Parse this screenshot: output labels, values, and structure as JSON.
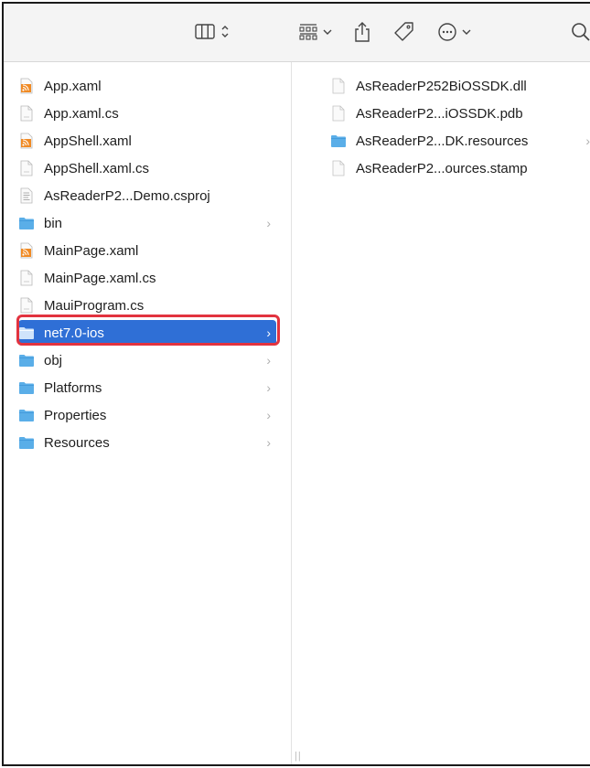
{
  "toolbar": {
    "icons": [
      "column-view-icon",
      "group-by-icon",
      "share-icon",
      "tag-icon",
      "more-actions-icon",
      "search-icon"
    ]
  },
  "colors": {
    "selection": "#2f6fd6",
    "highlight_border": "#e2333f",
    "folder": "#5aaee8"
  },
  "column1": {
    "items": [
      {
        "label": "App.xaml",
        "kind": "xaml"
      },
      {
        "label": "App.xaml.cs",
        "kind": "doc"
      },
      {
        "label": "AppShell.xaml",
        "kind": "xaml"
      },
      {
        "label": "AppShell.xaml.cs",
        "kind": "doc"
      },
      {
        "label": "AsReaderP2...Demo.csproj",
        "kind": "proj"
      },
      {
        "label": "bin",
        "kind": "folder",
        "expandable": true
      },
      {
        "label": "MainPage.xaml",
        "kind": "xaml"
      },
      {
        "label": "MainPage.xaml.cs",
        "kind": "doc"
      },
      {
        "label": "MauiProgram.cs",
        "kind": "doc"
      },
      {
        "label": "net7.0-ios",
        "kind": "folder",
        "expandable": true,
        "selected": true
      },
      {
        "label": "obj",
        "kind": "folder",
        "expandable": true
      },
      {
        "label": "Platforms",
        "kind": "folder",
        "expandable": true
      },
      {
        "label": "Properties",
        "kind": "folder",
        "expandable": true
      },
      {
        "label": "Resources",
        "kind": "folder",
        "expandable": true
      }
    ]
  },
  "column2": {
    "items": [
      {
        "label": "AsReaderP252BiOSSDK.dll",
        "kind": "blank"
      },
      {
        "label": "AsReaderP2...iOSSDK.pdb",
        "kind": "blank"
      },
      {
        "label": "AsReaderP2...DK.resources",
        "kind": "folder",
        "expandable": true
      },
      {
        "label": "AsReaderP2...ources.stamp",
        "kind": "blank"
      }
    ]
  },
  "chevron_glyph": "›",
  "resize_handle_glyph": "||"
}
